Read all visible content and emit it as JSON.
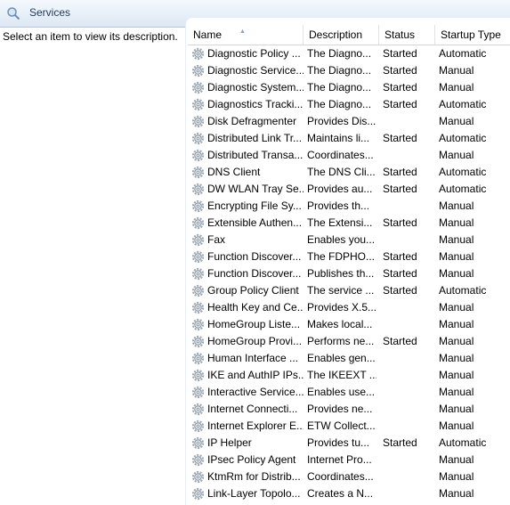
{
  "window": {
    "title": "Services"
  },
  "description_pane": {
    "text": "Select an item to view its description."
  },
  "columns": {
    "name": "Name",
    "description": "Description",
    "status": "Status",
    "startup": "Startup Type"
  },
  "services": [
    {
      "name": "Diagnostic Policy ...",
      "description": "The Diagno...",
      "status": "Started",
      "startup": "Automatic"
    },
    {
      "name": "Diagnostic Service...",
      "description": "The Diagno...",
      "status": "Started",
      "startup": "Manual"
    },
    {
      "name": "Diagnostic System...",
      "description": "The Diagno...",
      "status": "Started",
      "startup": "Manual"
    },
    {
      "name": "Diagnostics Tracki...",
      "description": "The Diagno...",
      "status": "Started",
      "startup": "Automatic"
    },
    {
      "name": "Disk Defragmenter",
      "description": "Provides Dis...",
      "status": "",
      "startup": "Manual"
    },
    {
      "name": "Distributed Link Tr...",
      "description": "Maintains li...",
      "status": "Started",
      "startup": "Automatic"
    },
    {
      "name": "Distributed Transa...",
      "description": "Coordinates...",
      "status": "",
      "startup": "Manual"
    },
    {
      "name": "DNS Client",
      "description": "The DNS Cli...",
      "status": "Started",
      "startup": "Automatic"
    },
    {
      "name": "DW WLAN Tray Se...",
      "description": "Provides au...",
      "status": "Started",
      "startup": "Automatic"
    },
    {
      "name": "Encrypting File Sy...",
      "description": "Provides th...",
      "status": "",
      "startup": "Manual"
    },
    {
      "name": "Extensible Authen...",
      "description": "The Extensi...",
      "status": "Started",
      "startup": "Manual"
    },
    {
      "name": "Fax",
      "description": "Enables you...",
      "status": "",
      "startup": "Manual"
    },
    {
      "name": "Function Discover...",
      "description": "The FDPHO...",
      "status": "Started",
      "startup": "Manual"
    },
    {
      "name": "Function Discover...",
      "description": "Publishes th...",
      "status": "Started",
      "startup": "Manual"
    },
    {
      "name": "Group Policy Client",
      "description": "The service ...",
      "status": "Started",
      "startup": "Automatic"
    },
    {
      "name": "Health Key and Ce...",
      "description": "Provides X.5...",
      "status": "",
      "startup": "Manual"
    },
    {
      "name": "HomeGroup Liste...",
      "description": "Makes local...",
      "status": "",
      "startup": "Manual"
    },
    {
      "name": "HomeGroup Provi...",
      "description": "Performs ne...",
      "status": "Started",
      "startup": "Manual"
    },
    {
      "name": "Human Interface ...",
      "description": "Enables gen...",
      "status": "",
      "startup": "Manual"
    },
    {
      "name": "IKE and AuthIP IPs...",
      "description": "The IKEEXT ...",
      "status": "",
      "startup": "Manual"
    },
    {
      "name": "Interactive Service...",
      "description": "Enables use...",
      "status": "",
      "startup": "Manual"
    },
    {
      "name": "Internet Connecti...",
      "description": "Provides ne...",
      "status": "",
      "startup": "Manual"
    },
    {
      "name": "Internet Explorer E...",
      "description": "ETW Collect...",
      "status": "",
      "startup": "Manual"
    },
    {
      "name": "IP Helper",
      "description": "Provides tu...",
      "status": "Started",
      "startup": "Automatic"
    },
    {
      "name": "IPsec Policy Agent",
      "description": "Internet Pro...",
      "status": "",
      "startup": "Manual"
    },
    {
      "name": "KtmRm for Distrib...",
      "description": "Coordinates...",
      "status": "",
      "startup": "Manual"
    },
    {
      "name": "Link-Layer Topolo...",
      "description": "Creates a N...",
      "status": "",
      "startup": "Manual"
    }
  ]
}
